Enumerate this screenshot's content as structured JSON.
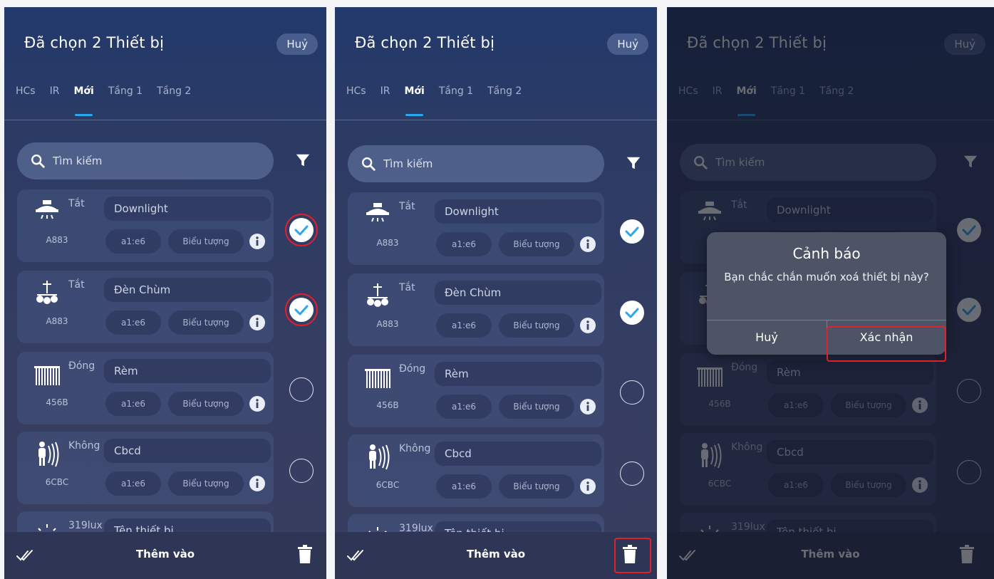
{
  "header": {
    "title": "Đã chọn 2 Thiết bị",
    "cancel_label": "Huỷ"
  },
  "tabs": [
    "HCs",
    "IR",
    "Mới",
    "Tầng 1",
    "Tầng 2"
  ],
  "active_tab": "Mới",
  "search": {
    "placeholder": "Tìm kiếm"
  },
  "devices": [
    {
      "icon": "downlight-icon",
      "state": "Tắt",
      "code": "A883",
      "name": "Downlight",
      "room": "a1:e6",
      "icon_label": "Biểu tượng",
      "selected": true
    },
    {
      "icon": "chandelier-icon",
      "state": "Tắt",
      "code": "A883",
      "name": "Đèn Chùm",
      "room": "a1:e6",
      "icon_label": "Biểu tượng",
      "selected": true
    },
    {
      "icon": "curtain-icon",
      "state": "Đóng",
      "code": "456B",
      "name": "Rèm",
      "room": "a1:e6",
      "icon_label": "Biểu tượng",
      "selected": false
    },
    {
      "icon": "motion-sensor-icon",
      "state": "Không",
      "code": "6CBC",
      "name": "Cbcd",
      "room": "a1:e6",
      "icon_label": "Biểu tượng",
      "selected": false
    },
    {
      "icon": "light-sensor-icon",
      "state": "319lux",
      "code": "",
      "name": "Tên thiết bị",
      "room": "",
      "icon_label": "",
      "selected": false
    }
  ],
  "bottom_bar": {
    "add_label": "Thêm vào"
  },
  "dialog": {
    "title": "Cảnh báo",
    "message": "Bạn chắc chắn muốn xoá thiết bị này?",
    "cancel_label": "Huỷ",
    "confirm_label": "Xác nhận"
  },
  "colors": {
    "accent": "#2aa7ef",
    "highlight": "#e0202c",
    "bar": "#2f3655"
  }
}
